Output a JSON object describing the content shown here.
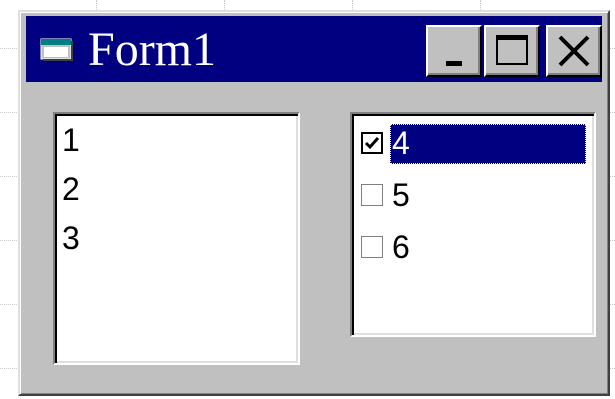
{
  "window": {
    "title": "Form1",
    "icon": "form-window-icon",
    "title_bar_color": "#000080",
    "face_color": "#c0c0c0",
    "buttons": {
      "minimize": "minimize-icon",
      "maximize": "maximize-icon",
      "close": "close-icon"
    }
  },
  "list1": {
    "items": [
      {
        "label": "1"
      },
      {
        "label": "2"
      },
      {
        "label": "3"
      }
    ]
  },
  "list2": {
    "items": [
      {
        "label": "4",
        "checked": true,
        "selected": true
      },
      {
        "label": "5",
        "checked": false,
        "selected": false
      },
      {
        "label": "6",
        "checked": false,
        "selected": false
      }
    ],
    "selection_color": "#000080"
  }
}
